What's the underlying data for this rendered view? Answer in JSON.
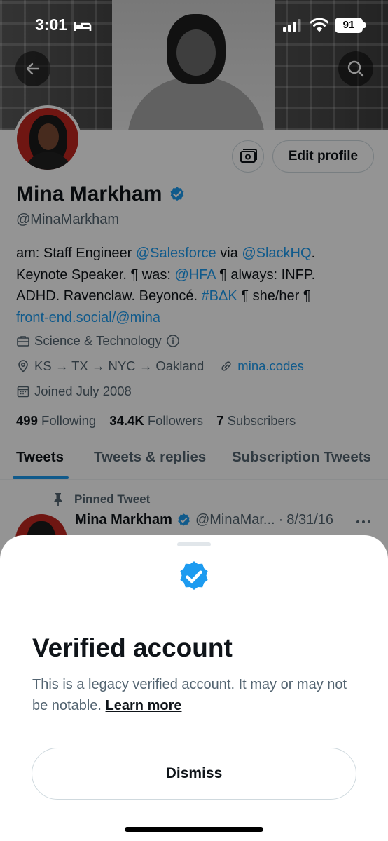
{
  "status_bar": {
    "time": "3:01",
    "battery": "91"
  },
  "profile": {
    "name": "Mina Markham",
    "handle": "@MinaMarkham",
    "edit_profile_label": "Edit profile",
    "bio": {
      "line1_a": "am: Staff Engineer ",
      "line1_link1": "@Salesforce",
      "line1_b": " via ",
      "line1_link2": "@SlackHQ",
      "line1_c": ".",
      "line2_a": "Keynote Speaker. ¶ was: ",
      "line2_link": "@HFA",
      "line2_b": " ¶ always: INFP.",
      "line3_a": "ADHD. Ravenclaw. Beyoncé. ",
      "line3_link": "#BΔK",
      "line3_b": " ¶ she/her ¶",
      "line4_link": "front-end.social/@mina"
    },
    "category": "Science & Technology",
    "location": "KS → TX → NYC → Oakland",
    "website": "mina.codes",
    "joined": "Joined July 2008",
    "stats": {
      "following_count": "499",
      "following_label": "Following",
      "followers_count": "34.4K",
      "followers_label": "Followers",
      "subscribers_count": "7",
      "subscribers_label": "Subscribers"
    }
  },
  "tabs": [
    "Tweets",
    "Tweets & replies",
    "Subscription Tweets"
  ],
  "pinned_tweet": {
    "pinned_label": "Pinned Tweet",
    "author": "Mina Markham",
    "handle": "@MinaMar...",
    "separator": "·",
    "date": "8/31/16"
  },
  "sheet": {
    "title": "Verified account",
    "body": "This is a legacy verified account. It may or may not be notable.",
    "learn_more": "Learn more",
    "dismiss_label": "Dismiss"
  },
  "colors": {
    "accent": "#1d9bf0",
    "text": "#0f1419",
    "secondary": "#536471"
  }
}
